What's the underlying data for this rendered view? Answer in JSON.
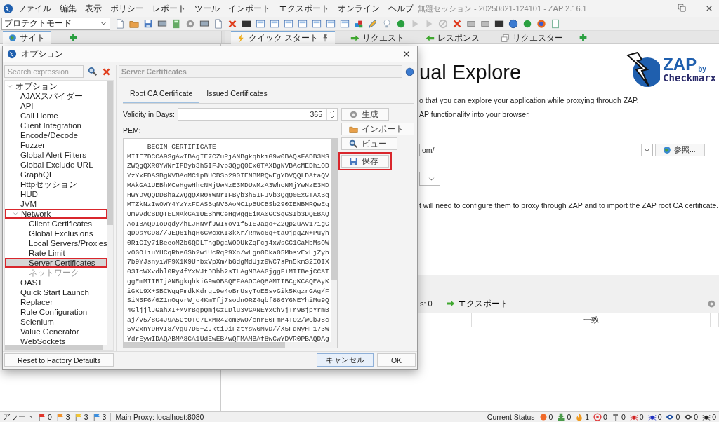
{
  "app_bar": {
    "menu": [
      "ファイル",
      "編集",
      "表示",
      "ポリシー",
      "レポート",
      "ツール",
      "インポート",
      "エクスポート",
      "オンライン",
      "ヘルプ"
    ],
    "title": "無題セッション - 20250821-124101 - ZAP 2.16.1"
  },
  "toolbar": {
    "mode": "プロテクトモード"
  },
  "left_tabs": [
    {
      "label": "サイト",
      "selected": true
    }
  ],
  "workspace_tabs": [
    {
      "label": "クイック スタート",
      "kind": "quickstart",
      "selected": true
    },
    {
      "label": "リクエスト",
      "kind": "request",
      "selected": false
    },
    {
      "label": "レスポンス",
      "kind": "response",
      "selected": false
    },
    {
      "label": "リクエスター",
      "kind": "requester",
      "selected": false
    }
  ],
  "quick_start": {
    "heading": "ual Explore",
    "lines": [
      "o that you can explore your application while proxying through ZAP.",
      "AP functionality into your browser."
    ],
    "url_value": "om/",
    "browse_button": "参照...",
    "note": "t will need to configure them to proxy through ZAP and to import the ZAP root CA certificate."
  },
  "logo": {
    "name": "ZAP",
    "by": "by",
    "brand": "Checkmarx"
  },
  "bottom_panel": {
    "count_label": "s: 0",
    "export_button": "エクスポート",
    "columns": [
      "一致"
    ]
  },
  "options_dialog": {
    "title": "オプション",
    "search": {
      "placeholder": "Search expression"
    },
    "tree": [
      {
        "label": "オプション",
        "selected": false,
        "highlighted": false,
        "disabled": false,
        "expanded": true,
        "children": [
          {
            "label": "AJAXスパイダー",
            "selected": false,
            "highlighted": false,
            "disabled": false
          },
          {
            "label": "API",
            "selected": false,
            "highlighted": false,
            "disabled": false
          },
          {
            "label": "Call Home",
            "selected": false,
            "highlighted": false,
            "disabled": false
          },
          {
            "label": "Client Integration",
            "selected": false,
            "highlighted": false,
            "disabled": false
          },
          {
            "label": "Encode/Decode",
            "selected": false,
            "highlighted": false,
            "disabled": false
          },
          {
            "label": "Fuzzer",
            "selected": false,
            "highlighted": false,
            "disabled": false
          },
          {
            "label": "Global Alert Filters",
            "selected": false,
            "highlighted": false,
            "disabled": false
          },
          {
            "label": "Global Exclude URL",
            "selected": false,
            "highlighted": false,
            "disabled": false
          },
          {
            "label": "GraphQL",
            "selected": false,
            "highlighted": false,
            "disabled": false
          },
          {
            "label": "Httpセッション",
            "selected": false,
            "highlighted": false,
            "disabled": false
          },
          {
            "label": "HUD",
            "selected": false,
            "highlighted": false,
            "disabled": false
          },
          {
            "label": "JVM",
            "selected": false,
            "highlighted": false,
            "disabled": false
          },
          {
            "label": "Network",
            "selected": false,
            "highlighted": true,
            "disabled": false,
            "expanded": true,
            "children": [
              {
                "label": "Client Certificates",
                "selected": false,
                "highlighted": false,
                "disabled": false
              },
              {
                "label": "Global Exclusions",
                "selected": false,
                "highlighted": false,
                "disabled": false
              },
              {
                "label": "Local Servers/Proxies",
                "selected": false,
                "highlighted": false,
                "disabled": false
              },
              {
                "label": "Rate Limit",
                "selected": false,
                "highlighted": false,
                "disabled": false
              },
              {
                "label": "Server Certificates",
                "selected": true,
                "highlighted": true,
                "disabled": false
              },
              {
                "label": "ネットワーク",
                "selected": false,
                "highlighted": false,
                "disabled": true
              }
            ]
          },
          {
            "label": "OAST",
            "selected": false,
            "highlighted": false,
            "disabled": false
          },
          {
            "label": "Quick Start Launch",
            "selected": false,
            "highlighted": false,
            "disabled": false
          },
          {
            "label": "Replacer",
            "selected": false,
            "highlighted": false,
            "disabled": false
          },
          {
            "label": "Rule Configuration",
            "selected": false,
            "highlighted": false,
            "disabled": false
          },
          {
            "label": "Selenium",
            "selected": false,
            "highlighted": false,
            "disabled": false
          },
          {
            "label": "Value Generator",
            "selected": false,
            "highlighted": false,
            "disabled": false
          },
          {
            "label": "WebSockets",
            "selected": false,
            "highlighted": false,
            "disabled": false
          }
        ]
      }
    ],
    "panel_title": "Server Certificates",
    "tabs": [
      {
        "label": "Root CA Certificate",
        "selected": true
      },
      {
        "label": "Issued Certificates",
        "selected": false
      }
    ],
    "validity_label": "Validity in Days:",
    "validity_value": "365",
    "pem_label": "PEM:",
    "pem_lines": [
      "-----BEGIN CERTIFICATE-----",
      "MIIE7DCCA9SgAwIBAgIE7CZuPjANBgkqhkiG9w0BAQsFADB3MS",
      "ZWQgQXR0YWNrIFByb3h5IFJvb3QgQ0ExGTAXBgNVBAcMEDhiOD",
      "YzYxFDASBgNVBAoMC1pBUCBSb290IENBMRQwEgYDVQQLDAtaQV",
      "MAkGA1UEBhMCeHgwHhcNMjUwNzE3MDUwMzA3WhcNMjYwNzE3MD",
      "HwYDVQQDDBhaZWQgQXR0YWNrIFByb3h5IFJvb3QgQ0ExGTAXBg",
      "MTZkNzIwOWY4YzYxFDASBgNVBAoMC1pBUCBSb290IENBMRQwEg",
      "Um9vdCBDQTELMAkGA1UEBhMCeHgwggEiMA0GCSqGSIb3DQEBAQ",
      "AoIBAQDIoDqdy/hLJHNVfJWIYov1f5IEJaqo+Z2Qp2uAv17igG",
      "qDOsYCD8//JEQ61hqH6GWcxKI3kXr/RnWc6q+taOjgqZN+Puyh",
      "0RiGIy71BeeoMZb6QDLThgDgaWOOUkZqFcj4xWsGC1CaMbMsOW",
      "v0GOliuYHCqRhe6Sb2w1UcRqP9Xn/wLgn0Dka05MbsvExHjZyb",
      "7b9YJsnyiWF9X1K9UrbxVpXm/bGdgMdUjz9WC7sPn5kmS2IOIX",
      "03IcWXvdbl0Ry4fYxWJtDDhh2sTLAgMBAAGjggF+MIIBejCCAT",
      "ggEmMIIBIjANBgkqhkiG9w0BAQEFAAOCAQ8AMIIBCgKCAQEAyK",
      "iGKL9X+SBCWqqPmdkKdrgL9e4oBrUsyToE5svGik5KgzrGAg/F",
      "SiN5F6/0Z1nOqvrWjo4KmTfj7sodnORZ4qbf886Y6NEYhiMu9Q",
      "4GljjlJGahXI+MVrBgpQmjGzLDlu3vGANEYxChVjTr9BjpYrmB",
      "aj/V5/8C4J9A5GtOTG7LxMR42cm0wO/cnrE0FmM4TO2/WCbJ8c",
      "5v2xnYDHVI8/Vgu7D5+ZJktiDiFztYsw6MVD//X5FdNyHF173W",
      "YdrEywIDAQABMA8GA1UdEwEB/wQFMAMBAf8wCwYDVR0PBAQDAg"
    ],
    "actions": [
      {
        "label": "生成",
        "kind": "gear",
        "highlighted": false
      },
      {
        "label": "インポート",
        "kind": "folder",
        "highlighted": false
      },
      {
        "label": "ビュー",
        "kind": "magnifier",
        "highlighted": false
      },
      {
        "label": "保存",
        "kind": "disk",
        "highlighted": true
      }
    ],
    "reset_button": "Reset to Factory Defaults",
    "buttons": [
      {
        "label": "キャンセル",
        "focused": true
      },
      {
        "label": "OK",
        "focused": false
      }
    ]
  },
  "status_bar": {
    "alerts_label": "アラート",
    "alert_flags": [
      {
        "count": "0",
        "color": "#e0352b"
      },
      {
        "count": "3",
        "color": "#f0922b"
      },
      {
        "count": "3",
        "color": "#f2c531"
      },
      {
        "count": "3",
        "color": "#3a8ee0"
      }
    ],
    "proxy": "Main Proxy: localhost:8080",
    "current_status_label": "Current Status",
    "counters": [
      {
        "kind": "circle",
        "color": "#f06a2a",
        "count": "0"
      },
      {
        "kind": "download",
        "color": "#4a9a4a",
        "count": "0"
      },
      {
        "kind": "flame",
        "color": "#f09a20",
        "count": "1"
      },
      {
        "kind": "target",
        "color": "#e04040",
        "count": "0"
      },
      {
        "kind": "hammer",
        "color": "#777777",
        "count": "0"
      },
      {
        "kind": "spider",
        "color": "#d02020",
        "count": "0"
      },
      {
        "kind": "spider",
        "color": "#2030c0",
        "count": "0"
      },
      {
        "kind": "eye",
        "color": "#2050a0",
        "count": "0"
      },
      {
        "kind": "eye",
        "color": "#444444",
        "count": "0"
      },
      {
        "kind": "spider",
        "color": "#222222",
        "count": "0"
      }
    ]
  }
}
